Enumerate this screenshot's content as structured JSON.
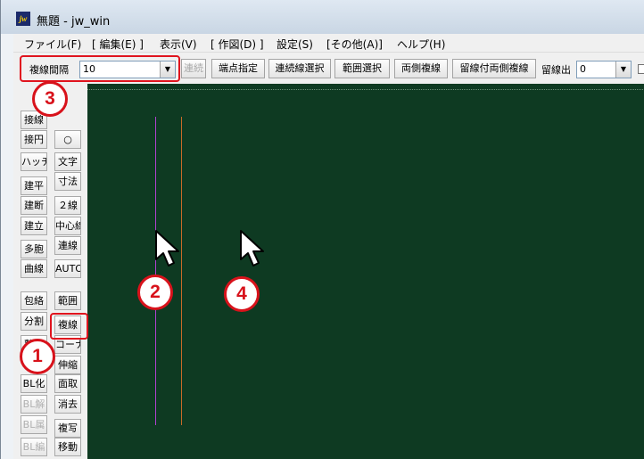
{
  "window": {
    "title": "無題 - jw_win",
    "app_icon_label": "jw"
  },
  "menu": [
    {
      "label": "ファイル(F)"
    },
    {
      "label": "[ 編集(E) ]"
    },
    {
      "label": "表示(V)"
    },
    {
      "label": "[ 作図(D) ]"
    },
    {
      "label": "設定(S)"
    },
    {
      "label": "[その他(A)]"
    },
    {
      "label": "ヘルプ(H)"
    }
  ],
  "toolbar": {
    "interval_label": "複線間隔",
    "interval_value": "10",
    "renzoku": "連続",
    "tanten_shitei": "端点指定",
    "renzokusen_sentaku": "連続線選択",
    "hani_sentaku": "範囲選択",
    "ryougawa_fukusen": "両側複線",
    "tomezuke_ryougawa_fukusen": "留線付両側複線",
    "tomesen_de_label": "留線出",
    "tomesen_de_value": "0"
  },
  "sidebar": {
    "col1": [
      "接線",
      "接円",
      "ハッチ",
      "建平",
      "建断",
      "建立",
      "多胞",
      "曲線",
      "包絡",
      "分割",
      "整理",
      "BL化",
      "BL解",
      "BL属",
      "BL編"
    ],
    "col2": [
      "○",
      "文字",
      "寸法",
      "２線",
      "中心線",
      "連線",
      "AUTO",
      "範囲",
      "複線",
      "コーナー",
      "伸縮",
      "面取",
      "消去",
      "複写",
      "移動"
    ],
    "col1_disabled": [
      "BL解",
      "BL属",
      "BL編"
    ]
  },
  "badges": {
    "b1": "1",
    "b2": "2",
    "b3": "3",
    "b4": "4"
  },
  "colors": {
    "canvas_bg": "#0e3a22",
    "line_purple": "#b040d0",
    "line_orange": "#c86a28",
    "badge_red": "#d8121b"
  }
}
